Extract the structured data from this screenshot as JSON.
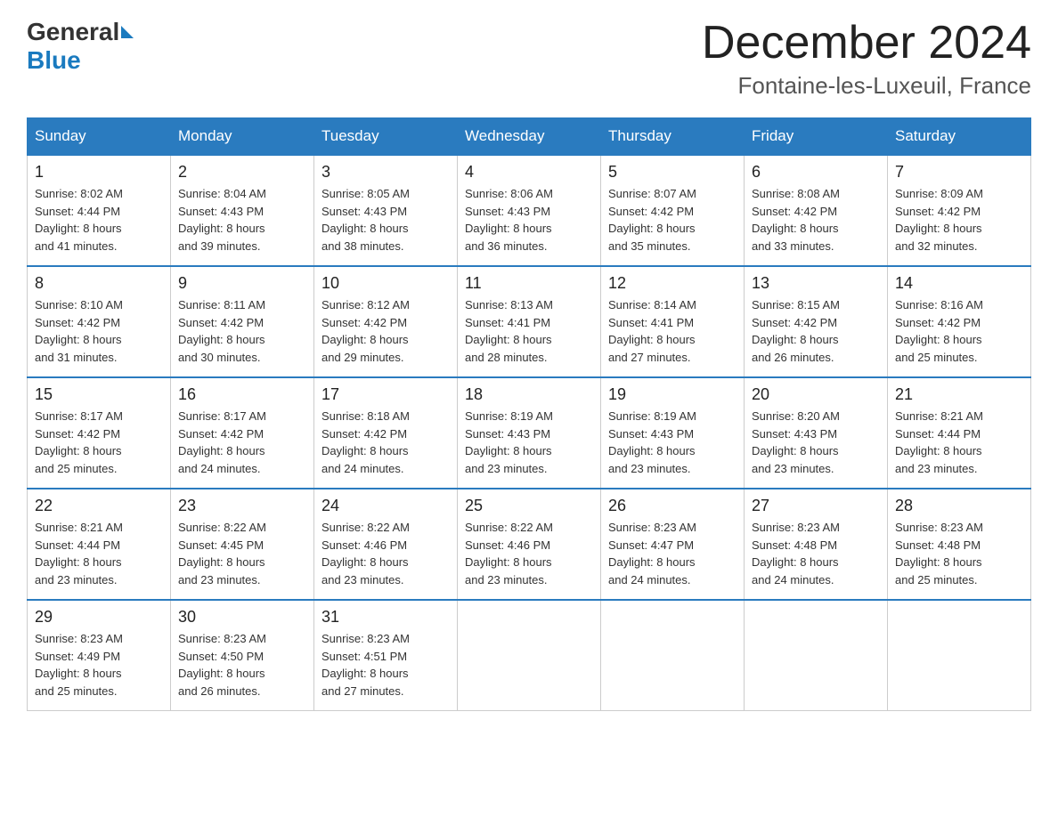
{
  "header": {
    "logo_general": "General",
    "logo_blue": "Blue",
    "month_title": "December 2024",
    "location": "Fontaine-les-Luxeuil, France"
  },
  "weekdays": [
    "Sunday",
    "Monday",
    "Tuesday",
    "Wednesday",
    "Thursday",
    "Friday",
    "Saturday"
  ],
  "weeks": [
    [
      {
        "day": "1",
        "sunrise": "8:02 AM",
        "sunset": "4:44 PM",
        "daylight": "8 hours and 41 minutes."
      },
      {
        "day": "2",
        "sunrise": "8:04 AM",
        "sunset": "4:43 PM",
        "daylight": "8 hours and 39 minutes."
      },
      {
        "day": "3",
        "sunrise": "8:05 AM",
        "sunset": "4:43 PM",
        "daylight": "8 hours and 38 minutes."
      },
      {
        "day": "4",
        "sunrise": "8:06 AM",
        "sunset": "4:43 PM",
        "daylight": "8 hours and 36 minutes."
      },
      {
        "day": "5",
        "sunrise": "8:07 AM",
        "sunset": "4:42 PM",
        "daylight": "8 hours and 35 minutes."
      },
      {
        "day": "6",
        "sunrise": "8:08 AM",
        "sunset": "4:42 PM",
        "daylight": "8 hours and 33 minutes."
      },
      {
        "day": "7",
        "sunrise": "8:09 AM",
        "sunset": "4:42 PM",
        "daylight": "8 hours and 32 minutes."
      }
    ],
    [
      {
        "day": "8",
        "sunrise": "8:10 AM",
        "sunset": "4:42 PM",
        "daylight": "8 hours and 31 minutes."
      },
      {
        "day": "9",
        "sunrise": "8:11 AM",
        "sunset": "4:42 PM",
        "daylight": "8 hours and 30 minutes."
      },
      {
        "day": "10",
        "sunrise": "8:12 AM",
        "sunset": "4:42 PM",
        "daylight": "8 hours and 29 minutes."
      },
      {
        "day": "11",
        "sunrise": "8:13 AM",
        "sunset": "4:41 PM",
        "daylight": "8 hours and 28 minutes."
      },
      {
        "day": "12",
        "sunrise": "8:14 AM",
        "sunset": "4:41 PM",
        "daylight": "8 hours and 27 minutes."
      },
      {
        "day": "13",
        "sunrise": "8:15 AM",
        "sunset": "4:42 PM",
        "daylight": "8 hours and 26 minutes."
      },
      {
        "day": "14",
        "sunrise": "8:16 AM",
        "sunset": "4:42 PM",
        "daylight": "8 hours and 25 minutes."
      }
    ],
    [
      {
        "day": "15",
        "sunrise": "8:17 AM",
        "sunset": "4:42 PM",
        "daylight": "8 hours and 25 minutes."
      },
      {
        "day": "16",
        "sunrise": "8:17 AM",
        "sunset": "4:42 PM",
        "daylight": "8 hours and 24 minutes."
      },
      {
        "day": "17",
        "sunrise": "8:18 AM",
        "sunset": "4:42 PM",
        "daylight": "8 hours and 24 minutes."
      },
      {
        "day": "18",
        "sunrise": "8:19 AM",
        "sunset": "4:43 PM",
        "daylight": "8 hours and 23 minutes."
      },
      {
        "day": "19",
        "sunrise": "8:19 AM",
        "sunset": "4:43 PM",
        "daylight": "8 hours and 23 minutes."
      },
      {
        "day": "20",
        "sunrise": "8:20 AM",
        "sunset": "4:43 PM",
        "daylight": "8 hours and 23 minutes."
      },
      {
        "day": "21",
        "sunrise": "8:21 AM",
        "sunset": "4:44 PM",
        "daylight": "8 hours and 23 minutes."
      }
    ],
    [
      {
        "day": "22",
        "sunrise": "8:21 AM",
        "sunset": "4:44 PM",
        "daylight": "8 hours and 23 minutes."
      },
      {
        "day": "23",
        "sunrise": "8:22 AM",
        "sunset": "4:45 PM",
        "daylight": "8 hours and 23 minutes."
      },
      {
        "day": "24",
        "sunrise": "8:22 AM",
        "sunset": "4:46 PM",
        "daylight": "8 hours and 23 minutes."
      },
      {
        "day": "25",
        "sunrise": "8:22 AM",
        "sunset": "4:46 PM",
        "daylight": "8 hours and 23 minutes."
      },
      {
        "day": "26",
        "sunrise": "8:23 AM",
        "sunset": "4:47 PM",
        "daylight": "8 hours and 24 minutes."
      },
      {
        "day": "27",
        "sunrise": "8:23 AM",
        "sunset": "4:48 PM",
        "daylight": "8 hours and 24 minutes."
      },
      {
        "day": "28",
        "sunrise": "8:23 AM",
        "sunset": "4:48 PM",
        "daylight": "8 hours and 25 minutes."
      }
    ],
    [
      {
        "day": "29",
        "sunrise": "8:23 AM",
        "sunset": "4:49 PM",
        "daylight": "8 hours and 25 minutes."
      },
      {
        "day": "30",
        "sunrise": "8:23 AM",
        "sunset": "4:50 PM",
        "daylight": "8 hours and 26 minutes."
      },
      {
        "day": "31",
        "sunrise": "8:23 AM",
        "sunset": "4:51 PM",
        "daylight": "8 hours and 27 minutes."
      },
      null,
      null,
      null,
      null
    ]
  ],
  "labels": {
    "sunrise": "Sunrise:",
    "sunset": "Sunset:",
    "daylight": "Daylight:"
  }
}
